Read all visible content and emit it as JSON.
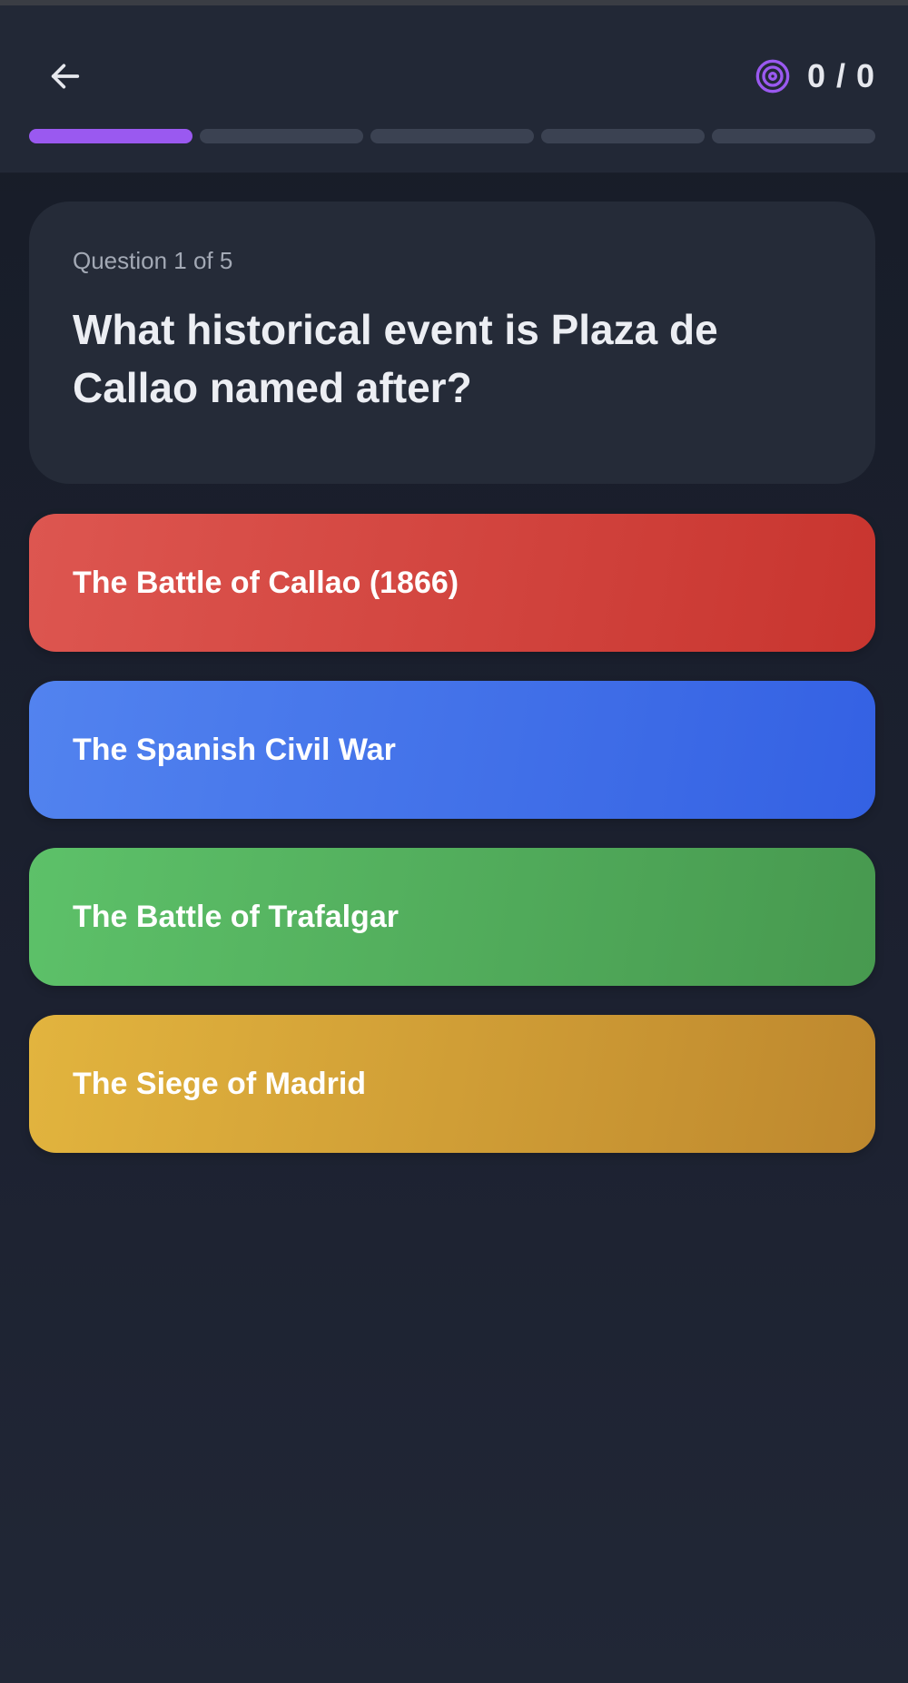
{
  "header": {
    "back_icon": "arrow-left-icon",
    "score_icon": "target-icon",
    "score_text": "0 / 0",
    "accent_color": "#9a59f0"
  },
  "progress": {
    "total_questions": 5,
    "current_question": 1
  },
  "question": {
    "counter": "Question 1 of 5",
    "text": "What historical event is Plaza de Callao named after?"
  },
  "answers": [
    {
      "label": "The Battle of Callao (1866)",
      "color": "#d4443e"
    },
    {
      "label": "The Spanish Civil War",
      "color": "#4472ea"
    },
    {
      "label": "The Battle of Trafalgar",
      "color": "#52ad5c"
    },
    {
      "label": "The Siege of Madrid",
      "color": "#d09e36"
    }
  ]
}
